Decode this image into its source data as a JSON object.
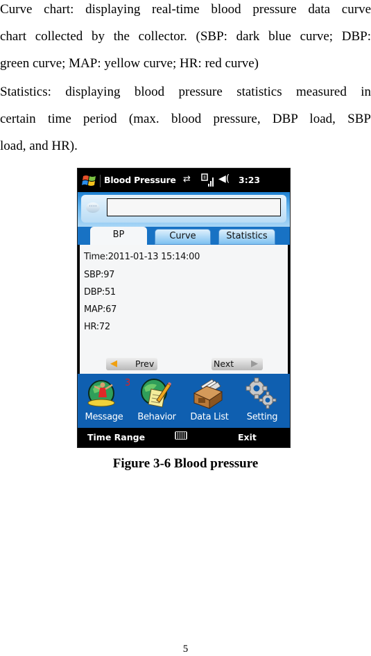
{
  "document": {
    "paragraph1_lines": [
      "Curve chart: displaying real-time blood pressure data curve",
      "chart collected by the collector. (SBP: dark blue curve; DBP:",
      "green curve; MAP: yellow curve; HR: red curve)"
    ],
    "paragraph2_lines": [
      "Statistics: displaying blood pressure statistics measured in",
      "certain time period (max. blood pressure, DBP load, SBP",
      "load, and HR)."
    ],
    "caption": "Figure 3-6 Blood pressure",
    "page_number": "5"
  },
  "phone": {
    "titlebar": {
      "logo_icon": "windows-flag-icon",
      "title": "Blood Pressure",
      "status_icons": [
        "sync-icon",
        "signal-icon",
        "volume-icon"
      ],
      "sync_glyph": "⇄",
      "volume_glyph": "◀(",
      "time": "3:23"
    },
    "message_input": {
      "value": "",
      "placeholder": ""
    },
    "chat_glyph": "····",
    "tabs": [
      {
        "label": "BP",
        "active": true
      },
      {
        "label": "Curve",
        "active": false
      },
      {
        "label": "Statistics",
        "active": false
      }
    ],
    "reading": {
      "time": "Time:2011-01-13 15:14:00",
      "sbp": "SBP:97",
      "dbp": "DBP:51",
      "map": "MAP:67",
      "hr": "HR:72"
    },
    "nav": {
      "prev_label": "Prev",
      "next_label": "Next",
      "prev_arrow": "◀",
      "next_arrow": "▶"
    },
    "launcher": [
      {
        "label": "Message",
        "icon": "message-globe-icon",
        "badge": "3"
      },
      {
        "label": "Behavior",
        "icon": "behavior-notepad-icon"
      },
      {
        "label": "Data List",
        "icon": "data-list-box-icon"
      },
      {
        "label": "Setting",
        "icon": "gears-icon"
      }
    ],
    "softkeys": {
      "left": "Time Range",
      "center_icon": "keyboard-icon",
      "right": "Exit"
    },
    "colors": {
      "title_bg": "#000000",
      "header_blue": "#1d7fd0",
      "tab_band": "#1872c4",
      "icon_band": "#0f5fb0",
      "badge_red": "#e02020",
      "content_bg": "#f5f6f7"
    }
  }
}
